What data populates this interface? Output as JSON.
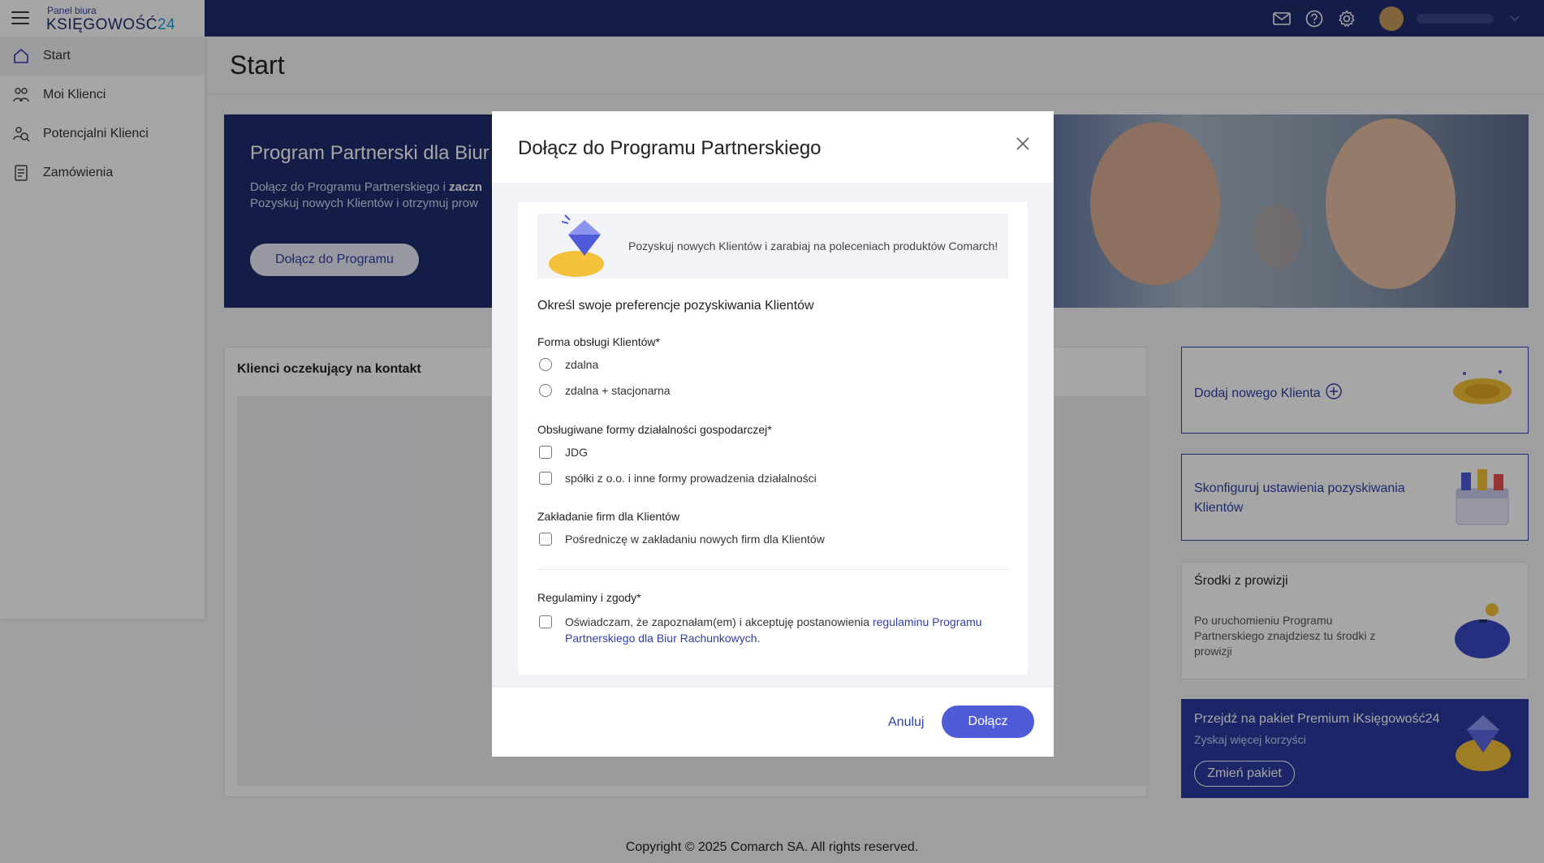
{
  "brand": {
    "small": "Panel biura",
    "big": "KSIĘGOWOŚĆ",
    "num": "24"
  },
  "colors": {
    "navy": "#1f2b6f",
    "accent": "#2f3fa8",
    "button": "#4f5bd8",
    "premium": "#2b3a9e"
  },
  "topbar": {
    "icons": [
      "mail-icon",
      "help-icon",
      "settings-icon",
      "chevron-down-icon"
    ]
  },
  "sidebar": {
    "items": [
      {
        "label": "Start",
        "icon": "home-icon"
      },
      {
        "label": "Moi Klienci",
        "icon": "clients-icon"
      },
      {
        "label": "Potencjalni Klienci",
        "icon": "potential-clients-icon"
      },
      {
        "label": "Zamówienia",
        "icon": "orders-icon"
      }
    ]
  },
  "page": {
    "title": "Start"
  },
  "hero": {
    "title": "Program Partnerski dla Biur",
    "text_line1": "Dołącz do Programu Partnerskiego i",
    "text_bold": "zaczn",
    "text_line2": "Pozyskuj nowych Klientów i otrzymuj prow",
    "button": "Dołącz do Programu"
  },
  "clients": {
    "title": "Klienci oczekujący na kontakt"
  },
  "cards": {
    "add_client": "Dodaj nowego Klienta",
    "configure": "Skonfiguruj ustawienia pozyskiwania Klientów",
    "commission_title": "Środki z prowizji",
    "commission_text": "Po uruchomieniu Programu Partnerskiego znajdziesz tu środki z prowizji",
    "premium_title": "Przejdź na pakiet Premium iKsięgowość24",
    "premium_sub": "Zyskaj więcej korzyści",
    "premium_button": "Zmień pakiet"
  },
  "footer": "Copyright © 2025 Comarch SA. All rights reserved.",
  "modal": {
    "title": "Dołącz do Programu Partnerskiego",
    "promo": "Pozyskuj nowych Klientów i zarabiaj na poleceniach produktów Comarch!",
    "section": "Określ swoje preferencje pozyskiwania Klientów",
    "form_label": "Forma obsługi Klientów*",
    "form_options": [
      "zdalna",
      "zdalna + stacjonarna"
    ],
    "activity_label": "Obsługiwane formy działalności gospodarczej*",
    "activity_options": [
      "JDG",
      "spółki z o.o. i inne formy prowadzenia działalności"
    ],
    "founding_label": "Zakładanie firm dla Klientów",
    "founding_option": "Pośredniczę w zakładaniu nowych firm dla Klientów",
    "terms_label": "Regulaminy i zgody*",
    "terms_text": "Oświadczam, że zapoznałam(em) i akceptuję postanowienia ",
    "terms_link": "regulaminu Programu Partnerskiego dla Biur Rachunkowych.",
    "cancel": "Anuluj",
    "join": "Dołącz"
  }
}
